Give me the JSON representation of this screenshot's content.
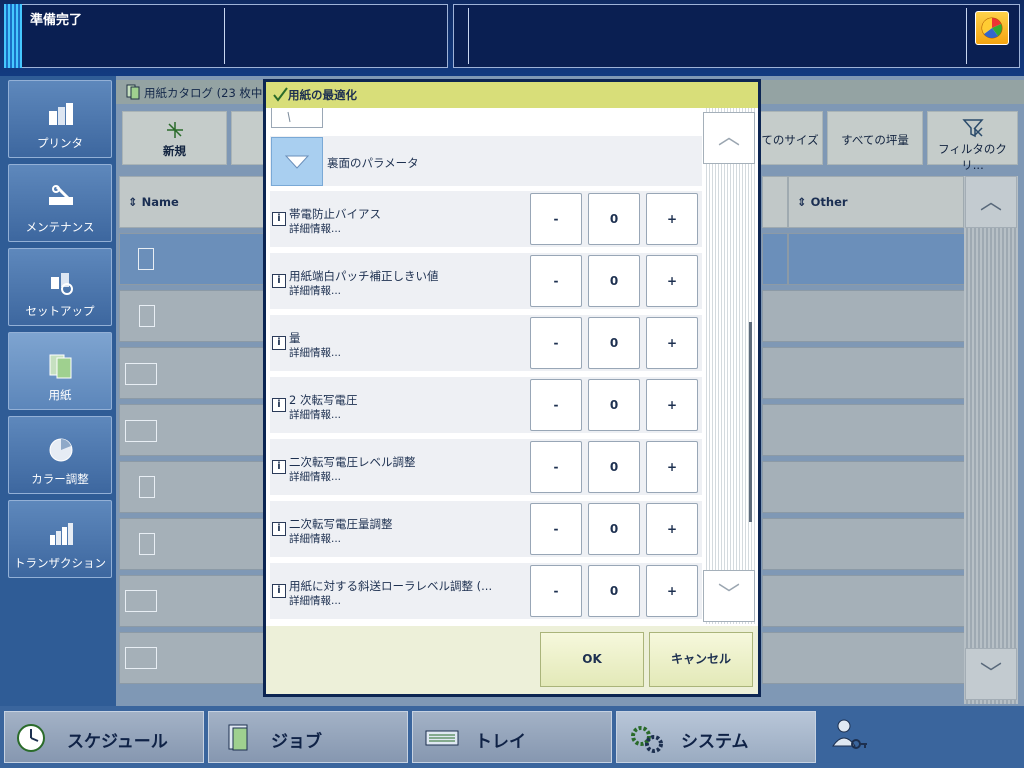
{
  "status": {
    "text": "準備完了"
  },
  "sidebar": {
    "items": [
      {
        "label": "プリンタ",
        "icon": "printer-icon"
      },
      {
        "label": "メンテナンス",
        "icon": "maintenance-icon"
      },
      {
        "label": "セットアップ",
        "icon": "setup-icon"
      },
      {
        "label": "用紙",
        "icon": "paper-icon"
      },
      {
        "label": "カラー調整",
        "icon": "color-adjust-icon"
      },
      {
        "label": "トランザクション",
        "icon": "transaction-icon"
      }
    ]
  },
  "catalog": {
    "title": "用紙カタログ (23 枚中、",
    "toolbar": {
      "new_label": "新規",
      "all_sizes": "てのサイズ",
      "all_weights": "すべての坪量",
      "filter_clear": "フィルタのクリ..."
    },
    "columns": {
      "name": "Name",
      "other": "Other"
    }
  },
  "dialog": {
    "title": "用紙の最適化",
    "section_label": "裏面のパラメータ",
    "detail_label": "詳細情報...",
    "settings": [
      {
        "name": "帯電防止バイアス",
        "value": "0"
      },
      {
        "name": "用紙端白パッチ補正しきい値",
        "value": "0"
      },
      {
        "name": "量",
        "value": "0"
      },
      {
        "name": "2 次転写電圧",
        "value": "0"
      },
      {
        "name": "二次転写電圧レベル調整",
        "value": "0"
      },
      {
        "name": "二次転写電圧量調整",
        "value": "0"
      },
      {
        "name": "用紙に対する斜送ローラレベル調整 (...",
        "value": "0"
      }
    ],
    "minus": "-",
    "plus": "+",
    "ok_label": "OK",
    "cancel_label": "キャンセル"
  },
  "bottom_nav": {
    "schedule": "スケジュール",
    "jobs": "ジョブ",
    "tray": "トレイ",
    "system": "システム"
  },
  "colors": {
    "accent": "#d8de79",
    "selected": "#a9cff0",
    "frame": "#0c2552"
  }
}
